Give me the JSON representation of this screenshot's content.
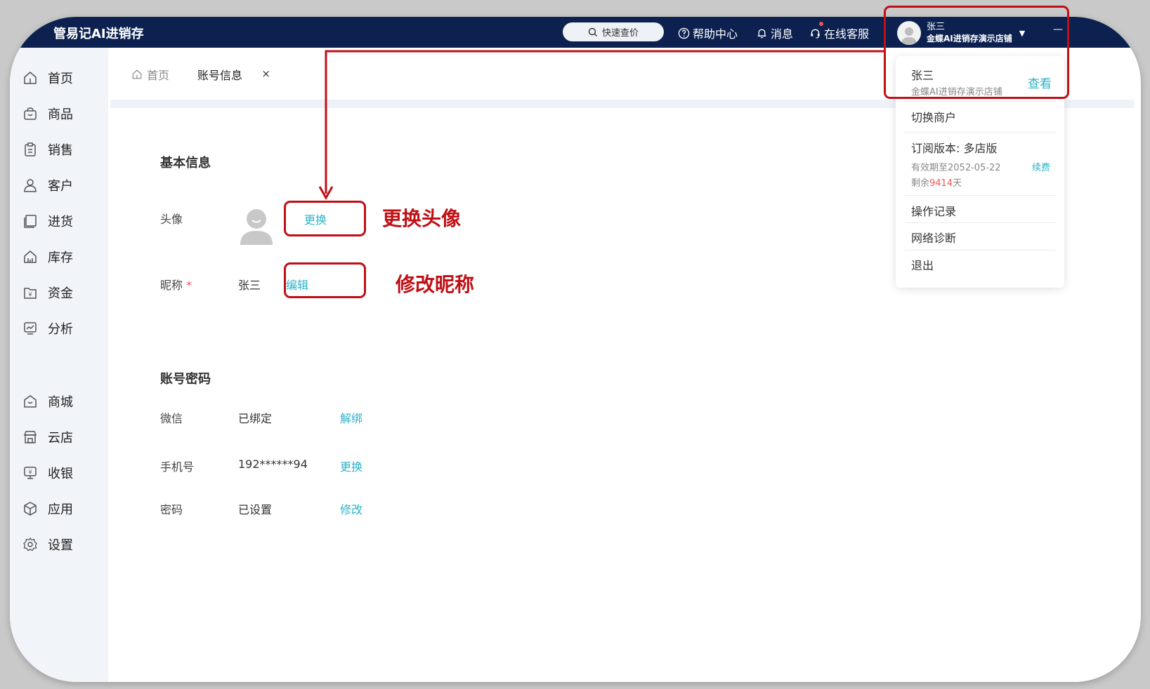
{
  "app": {
    "logo_text": "管易记AI进销存"
  },
  "header": {
    "search_label": "快速查价",
    "help": "帮助中心",
    "messages": "消息",
    "support": "在线客服",
    "user_name": "张三",
    "store_name": "金蝶AI进销存演示店铺",
    "minimize": "—"
  },
  "sidebar": {
    "items": [
      {
        "label": "首页",
        "icon": "home-icon"
      },
      {
        "label": "商品",
        "icon": "bag-icon"
      },
      {
        "label": "销售",
        "icon": "clipboard-icon"
      },
      {
        "label": "客户",
        "icon": "user-icon"
      },
      {
        "label": "进货",
        "icon": "purchase-icon"
      },
      {
        "label": "库存",
        "icon": "warehouse-icon"
      },
      {
        "label": "资金",
        "icon": "wallet-icon"
      },
      {
        "label": "分析",
        "icon": "chart-icon"
      },
      {
        "label": "商城",
        "icon": "mall-icon"
      },
      {
        "label": "云店",
        "icon": "store-icon"
      },
      {
        "label": "收银",
        "icon": "cashier-icon"
      },
      {
        "label": "应用",
        "icon": "app-icon"
      },
      {
        "label": "设置",
        "icon": "gear-icon"
      }
    ]
  },
  "tabs": {
    "home": "首页",
    "active": "账号信息",
    "close": "×"
  },
  "basic": {
    "title": "基本信息",
    "avatar_label": "头像",
    "avatar_action": "更换",
    "nickname_label": "昵称",
    "required_mark": "*",
    "nickname_value": "张三",
    "nickname_action": "编辑"
  },
  "account": {
    "title": "账号密码",
    "rows": [
      {
        "label": "微信",
        "value": "已绑定",
        "action": "解绑"
      },
      {
        "label": "手机号",
        "value": "192******94",
        "action": "更换"
      },
      {
        "label": "密码",
        "value": "已设置",
        "action": "修改"
      }
    ]
  },
  "dropdown": {
    "name": "张三",
    "store": "金蝶AI进销存演示店铺",
    "view": "查看",
    "switch_merchant": "切换商户",
    "subscription": "订阅版本: 多店版",
    "valid_until": "有效期至2052-05-22",
    "renew": "续费",
    "remaining_prefix": "剩余",
    "remaining_days": "9414",
    "remaining_suffix": "天",
    "operation_log": "操作记录",
    "network_diag": "网络诊断",
    "logout": "退出"
  },
  "annotations": {
    "avatar": "更换头像",
    "nickname": "修改昵称"
  },
  "colors": {
    "topbar": "#0c2150",
    "link": "#2bb3c8",
    "annotation": "#c00f15"
  }
}
